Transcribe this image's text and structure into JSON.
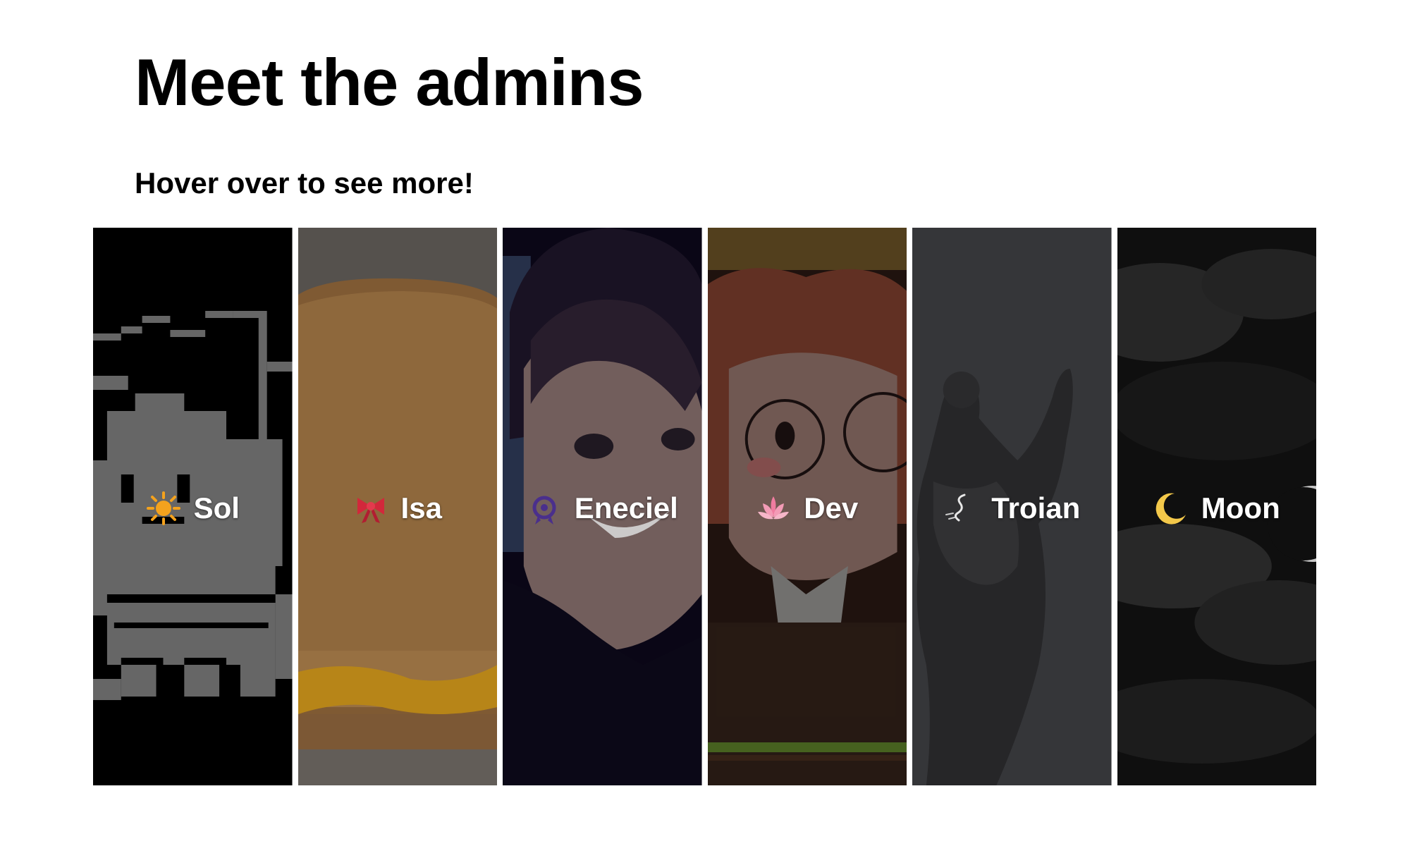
{
  "page": {
    "title": "Meet the admins",
    "subtitle": "Hover over to see more!"
  },
  "admins": [
    {
      "name": "Sol",
      "icon": "sun-emoji-icon",
      "art": "pixel-cat-image"
    },
    {
      "name": "Isa",
      "icon": "ribbon-emoji-icon",
      "art": "grilled-cheese-image"
    },
    {
      "name": "Eneciel",
      "icon": "purple-badge-icon",
      "art": "anime-girl-image"
    },
    {
      "name": "Dev",
      "icon": "lotus-emoji-icon",
      "art": "glasses-girl-image"
    },
    {
      "name": "Troian",
      "icon": "tornado-emoji-icon",
      "art": "statue-image"
    },
    {
      "name": "Moon",
      "icon": "crescent-moon-icon",
      "art": "eclipse-sky-image"
    }
  ],
  "colors": {
    "text": "#000000",
    "card_text": "#ffffff",
    "sol_bg": "#000000",
    "isa_bg": "#5b5652",
    "eneciel_bg": "#0b0718",
    "dev_bg": "#231510",
    "troian_bg": "#38393c",
    "moon_bg": "#101010"
  }
}
